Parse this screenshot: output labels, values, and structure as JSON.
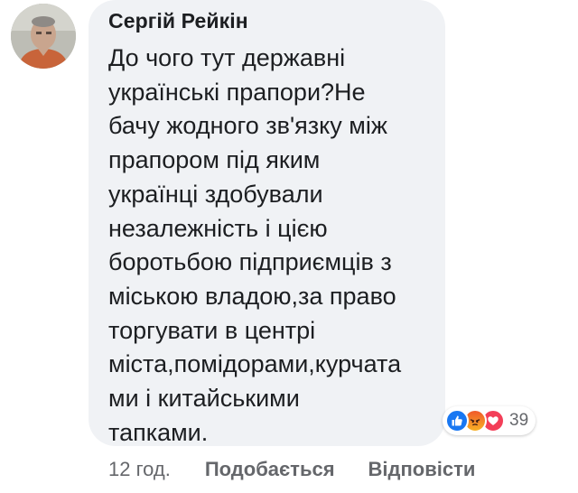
{
  "comment": {
    "author": "Сергій Рейкін",
    "text": "До чого тут державні\nукраїнські прапори?Не\nбачу жодного зв'язку між\nпрапором під яким\nукраїнці здобували\nнезалежність і цією\nборотьбою підприємців з\nміською владою,за право\nторгувати в центрі\nміста,помідорами,курчата\nми і китайськими\nтапками."
  },
  "reactions": {
    "types": [
      "like-icon",
      "angry-icon",
      "love-icon"
    ],
    "count": "39"
  },
  "actions": {
    "time": "12 год.",
    "like_label": "Подобається",
    "reply_label": "Відповісти"
  },
  "colors": {
    "bubble": "#f0f2f5",
    "text": "#1c1e21",
    "secondary": "#65676b",
    "like": "#1877f2",
    "love": "#f33e58"
  }
}
